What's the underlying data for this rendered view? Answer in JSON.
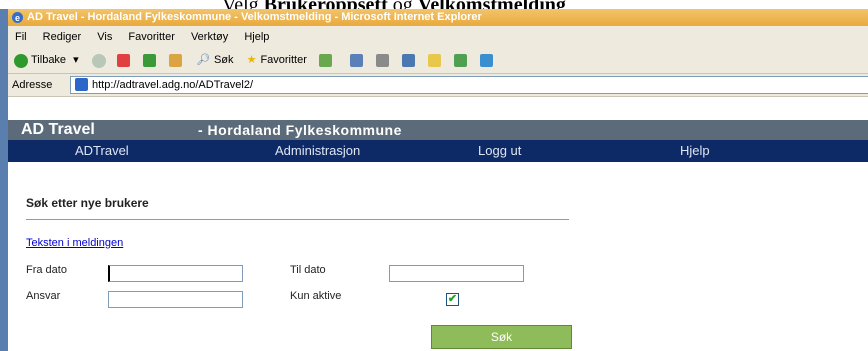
{
  "doc_heading": {
    "prefix": "Velg ",
    "bold1": "Brukeroppsett",
    "mid": " og ",
    "bold2": "Velkomstmelding"
  },
  "window": {
    "title": "AD Travel - Hordaland Fylkeskommune - Velkomstmelding - Microsoft Internet Explorer"
  },
  "menubar": {
    "items": [
      "Fil",
      "Rediger",
      "Vis",
      "Favoritter",
      "Verktøy",
      "Hjelp"
    ]
  },
  "toolbar": {
    "back_label": "Tilbake",
    "search_label": "Søk",
    "favorites_label": "Favoritter"
  },
  "address": {
    "label": "Adresse",
    "url": "http://adtravel.adg.no/ADTravel2/"
  },
  "app": {
    "brand": "AD Travel",
    "org": "- Hordaland Fylkeskommune"
  },
  "nav": {
    "items": [
      "ADTravel",
      "Administrasjon",
      "Logg ut",
      "Hjelp"
    ]
  },
  "form": {
    "heading": "Søk etter nye brukere",
    "link": "Teksten i meldingen",
    "fra_dato_label": "Fra dato",
    "fra_dato_value": "",
    "til_dato_label": "Til dato",
    "til_dato_value": "",
    "ansvar_label": "Ansvar",
    "ansvar_value": "",
    "kun_aktive_label": "Kun aktive",
    "kun_aktive_checked": true,
    "check_mark": "✔",
    "search_button": "Søk"
  },
  "colors": {
    "nav_bg": "#0d2a66",
    "title_bg": "#5c6b7a",
    "button_bg": "#8fbc5a"
  }
}
